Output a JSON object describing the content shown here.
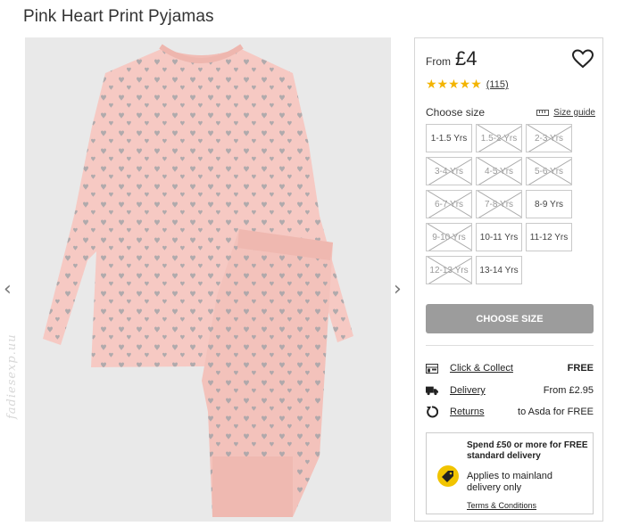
{
  "product": {
    "title": "Pink Heart Print Pyjamas",
    "watermark": "fadiesexp.uu"
  },
  "price": {
    "from_label": "From",
    "value": "£4"
  },
  "rating": {
    "stars": "★★★★★",
    "value_out_of_5": 5,
    "reviews": "(115)"
  },
  "sizes": {
    "heading": "Choose size",
    "guide_label": "Size guide",
    "options": [
      {
        "label": "1-1.5 Yrs",
        "available": true
      },
      {
        "label": "1.5-2 Yrs",
        "available": false
      },
      {
        "label": "2-3 Yrs",
        "available": false
      },
      {
        "label": "3-4 Yrs",
        "available": false
      },
      {
        "label": "4-5 Yrs",
        "available": false
      },
      {
        "label": "5-6 Yrs",
        "available": false
      },
      {
        "label": "6-7 Yrs",
        "available": false
      },
      {
        "label": "7-8 Yrs",
        "available": false
      },
      {
        "label": "8-9 Yrs",
        "available": true
      },
      {
        "label": "9-10 Yrs",
        "available": false
      },
      {
        "label": "10-11 Yrs",
        "available": true
      },
      {
        "label": "11-12 Yrs",
        "available": true
      },
      {
        "label": "12-13 Yrs",
        "available": false
      },
      {
        "label": "13-14 Yrs",
        "available": true
      }
    ]
  },
  "cta": {
    "label": "CHOOSE SIZE"
  },
  "delivery": [
    {
      "icon": "store-icon",
      "label": "Click & Collect",
      "value": "FREE"
    },
    {
      "icon": "truck-icon",
      "label": "Delivery",
      "value": "From £2.95"
    },
    {
      "icon": "returns-icon",
      "label": "Returns",
      "value": "to Asda for FREE"
    }
  ],
  "promo": {
    "headline": "Spend £50 or more for FREE standard delivery",
    "body": "Applies to mainland delivery only",
    "terms": "Terms & Conditions"
  },
  "colors": {
    "star": "#f3b400",
    "cta_bg": "#9c9c9c",
    "promo_tag": "#f1c400",
    "garment": "#f6c9c3",
    "heart_print": "#a4a4a8"
  }
}
